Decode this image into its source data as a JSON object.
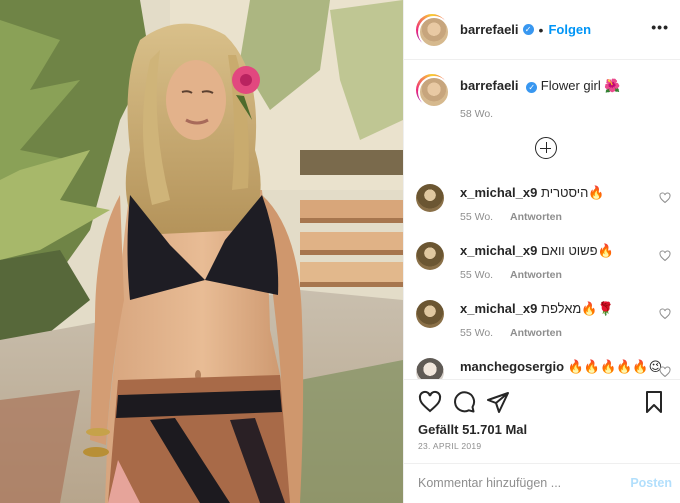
{
  "post": {
    "image_alt": "Photo of woman in a black bikini top with a pink flower in her hair in a sunny garden"
  },
  "header": {
    "username": "barrefaeli",
    "separator": "•",
    "follow_label": "Folgen",
    "more_icon": "more-horizontal-icon",
    "more_label": "•••"
  },
  "caption": {
    "username": "barrefaeli",
    "text": "Flower girl 🌺",
    "time": "58 Wo."
  },
  "load_more_icon": "plus-circle-icon",
  "comments": [
    {
      "username": "x_michal_x9",
      "text": "היסטרית🔥",
      "time": "55 Wo.",
      "reply_label": "Antworten"
    },
    {
      "username": "x_michal_x9",
      "text": "פשוט וואם🔥",
      "time": "55 Wo.",
      "reply_label": "Antworten"
    },
    {
      "username": "x_michal_x9",
      "text": "מאלפת🔥🌹",
      "time": "55 Wo.",
      "reply_label": "Antworten"
    },
    {
      "username": "manchegosergio",
      "text": "🔥🔥🔥🔥🔥😉",
      "time": "",
      "reply_label": ""
    }
  ],
  "actions": {
    "like_icon": "heart-icon",
    "comment_icon": "comment-icon",
    "share_icon": "paper-plane-icon",
    "save_icon": "bookmark-icon",
    "likes_text": "Gefällt 51.701 Mal",
    "date": "23. APRIL 2019"
  },
  "add_comment": {
    "placeholder": "Kommentar hinzufügen ...",
    "post_label": "Posten"
  },
  "colors": {
    "link_blue": "#0095f6",
    "verified_blue": "#3897f0",
    "disabled_post_blue": "#b2dffc",
    "muted_text": "#8e8e8e",
    "border": "#efefef"
  }
}
